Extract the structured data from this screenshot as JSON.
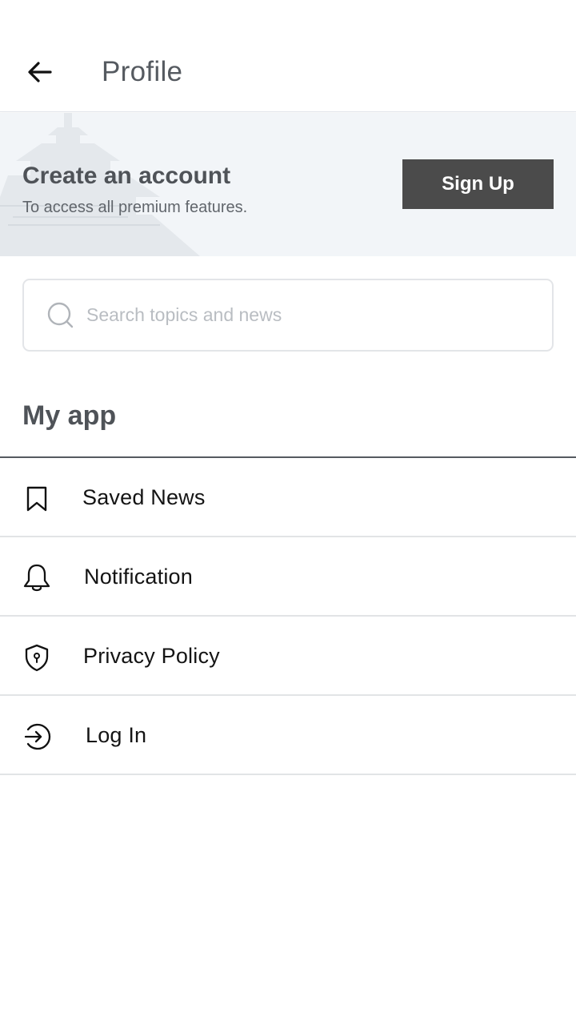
{
  "header": {
    "title": "Profile",
    "back_icon": "arrow-left-icon"
  },
  "banner": {
    "title": "Create an account",
    "subtitle": "To access all premium features.",
    "signup_label": "Sign Up",
    "background_color": "#f2f5f8",
    "button_color": "#4b4b4b"
  },
  "search": {
    "placeholder": "Search topics and news",
    "value": "",
    "icon": "search-icon"
  },
  "section": {
    "title": "My app"
  },
  "menu": {
    "items": [
      {
        "label": "Saved News",
        "icon": "bookmark-icon"
      },
      {
        "label": "Notification",
        "icon": "bell-icon"
      },
      {
        "label": "Privacy Policy",
        "icon": "shield-lock-icon"
      },
      {
        "label": "Log In",
        "icon": "login-icon"
      }
    ]
  }
}
